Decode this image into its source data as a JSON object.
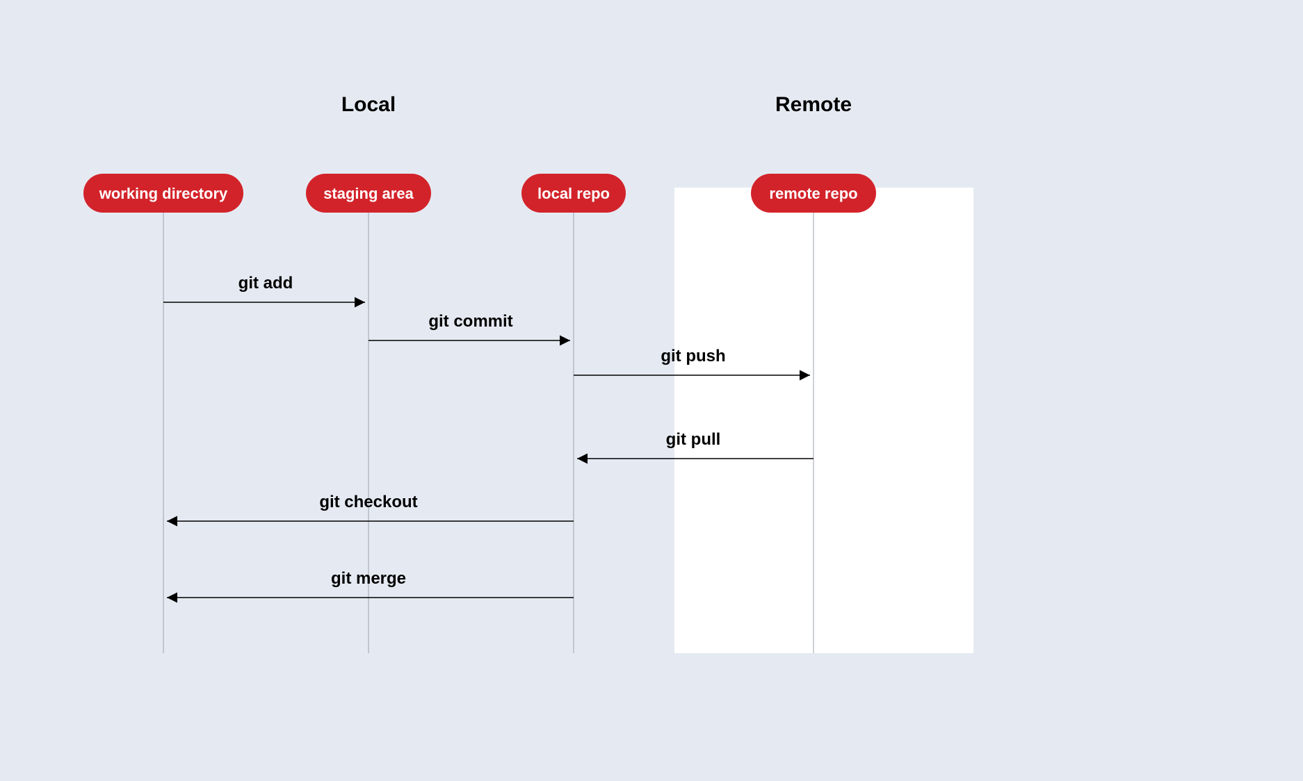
{
  "groups": {
    "local": "Local",
    "remote": "Remote"
  },
  "lanes": {
    "working_directory": "working directory",
    "staging_area": "staging area",
    "local_repo": "local repo",
    "remote_repo": "remote repo"
  },
  "commands": {
    "add": "git add",
    "commit": "git commit",
    "push": "git push",
    "pull": "git pull",
    "checkout": "git checkout",
    "merge": "git merge"
  },
  "colors": {
    "pill": "#d3232a",
    "background": "#e5eaf2",
    "remote_box": "#ffffff"
  }
}
